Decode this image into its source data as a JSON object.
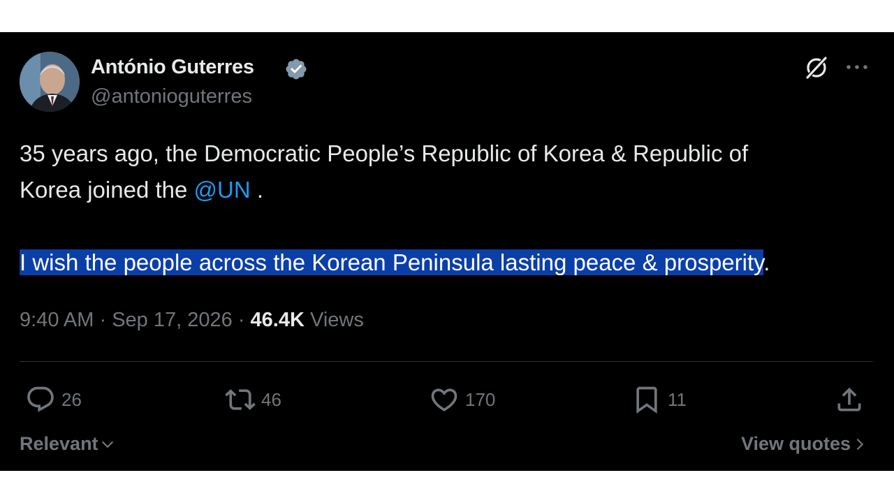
{
  "author": {
    "name": "António Guterres",
    "handle": "@antonioguterres",
    "verified": true
  },
  "tweet": {
    "line1": "35 years ago, the Democratic People’s Republic of Korea & Republic of",
    "line2_prefix": "Korea joined the ",
    "mention": "@UN",
    "line2_suffix": " .",
    "selected_text": "I wish the people across the Korean Peninsula lasting peace & prosperity",
    "trailing_text": "."
  },
  "meta": {
    "time": "9:40 AM",
    "separator": "·",
    "date": "Sep 17, 2026",
    "views_count": "46.4K",
    "views_label": "Views"
  },
  "actions": {
    "replies": "26",
    "reposts": "46",
    "likes": "170",
    "bookmarks": "11"
  },
  "footer": {
    "sort_label": "Relevant",
    "quotes_label": "View quotes"
  },
  "colors": {
    "background": "#000000",
    "text": "#e7e9ea",
    "muted": "#71767b",
    "link": "#1d9bf0",
    "verified": "#829aab",
    "selection": "#0b3fa8"
  },
  "icons": [
    "verified-badge-icon",
    "grok-icon",
    "more-icon",
    "reply-icon",
    "repost-icon",
    "like-icon",
    "bookmark-icon",
    "share-icon",
    "chevron-down-icon",
    "chevron-right-icon"
  ]
}
